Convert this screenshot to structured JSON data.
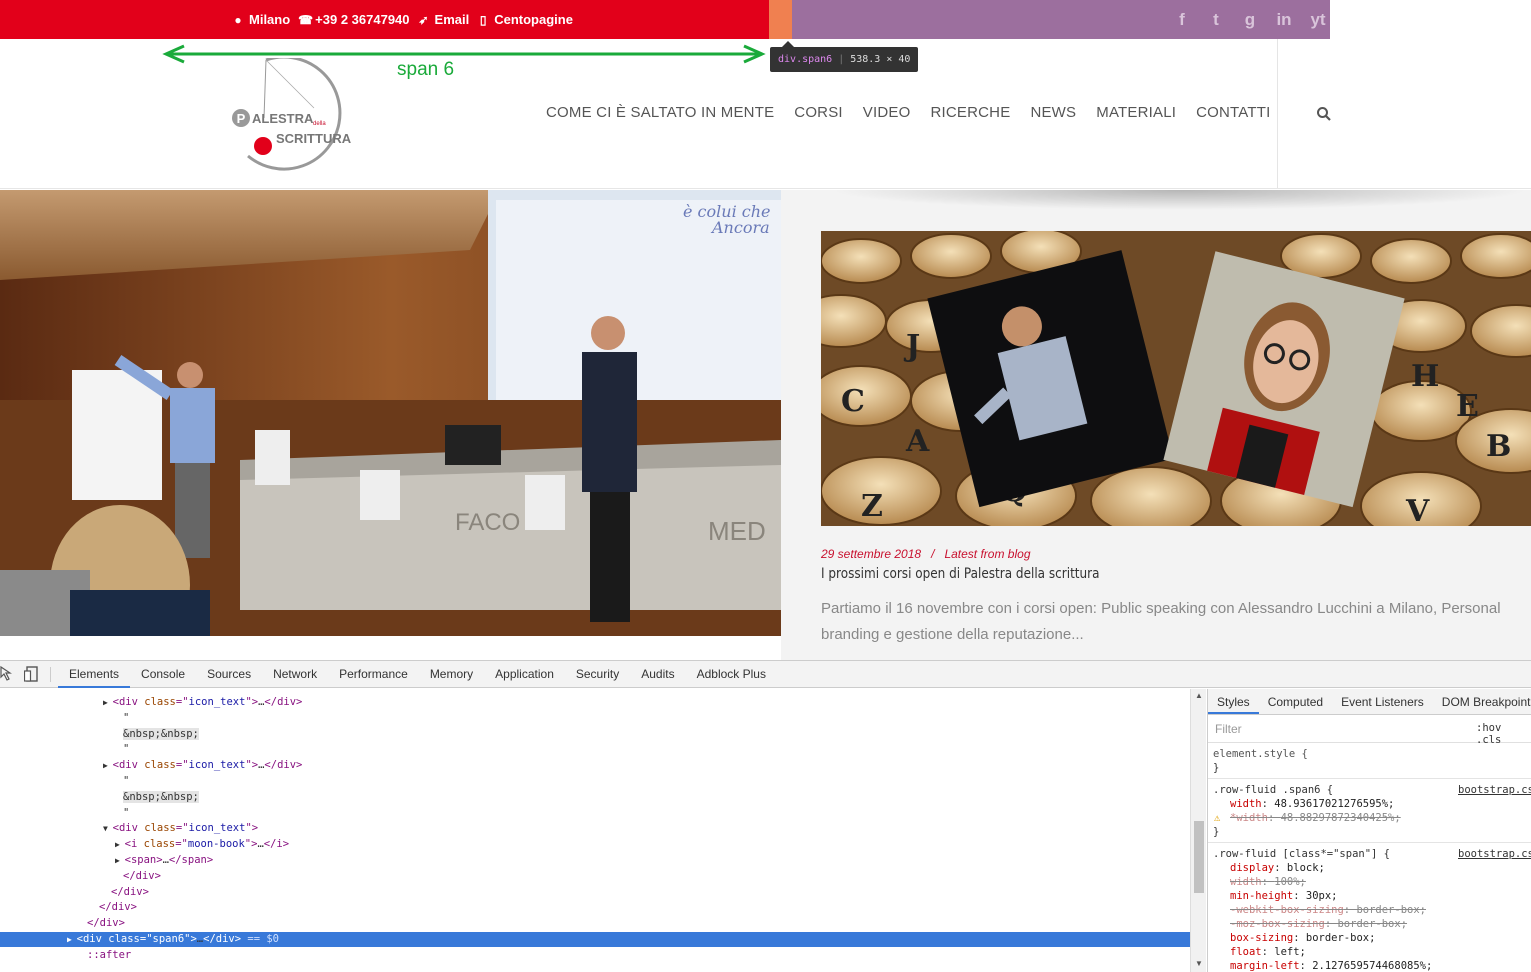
{
  "topbar": {
    "items": [
      {
        "icon": "map-marker-icon",
        "label": "Milano"
      },
      {
        "icon": "phone-icon",
        "label": "+39 2 36747940"
      },
      {
        "icon": "rocket-icon",
        "label": "Email"
      },
      {
        "icon": "book-icon",
        "label": "Centopagine"
      }
    ],
    "social": [
      "f",
      "t",
      "g",
      "in",
      "yt"
    ],
    "colors": {
      "red": "#e2001a",
      "purple": "#9c6f9e",
      "orange": "#f08050"
    }
  },
  "overlay": {
    "span_label": "span 6",
    "tooltip_tag": "div",
    "tooltip_class": ".span6",
    "tooltip_size": "538.3 × 40"
  },
  "logo": {
    "line1": "ALESTRA",
    "small": "della",
    "line2": "SCRITTURA",
    "initial": "P"
  },
  "nav": {
    "items": [
      "COME CI È SALTATO IN MENTE",
      "CORSI",
      "VIDEO",
      "RICERCHE",
      "NEWS",
      "MATERIALI",
      "CONTATTI"
    ]
  },
  "hero": {
    "slide_text_1": "è colui che",
    "slide_text_2": "Ancora",
    "desk_text": "FACO",
    "desk_text_2": "MED",
    "tiles": [
      "Q",
      "A",
      "B",
      "V",
      "H",
      "E",
      "Z",
      "C",
      "J"
    ]
  },
  "post": {
    "date": "29 settembre 2018",
    "separator": "/",
    "category": "Latest from blog",
    "title": "I prossimi corsi open di Palestra della scrittura",
    "excerpt": "Partiamo il 16 novembre con i corsi open: Public speaking con Alessandro Lucchini a Milano, Personal branding e gestione della reputazione..."
  },
  "devtools": {
    "tabs": [
      "Elements",
      "Console",
      "Sources",
      "Network",
      "Performance",
      "Memory",
      "Application",
      "Security",
      "Audits",
      "Adblock Plus"
    ],
    "active_tab": "Elements",
    "dom_lines": [
      {
        "indent": 113,
        "type": "collapsed",
        "tag": "div",
        "attr": "class",
        "value": "icon_text"
      },
      {
        "indent": 123,
        "type": "text",
        "text": "\""
      },
      {
        "indent": 123,
        "type": "entity",
        "text": "&nbsp;&nbsp;"
      },
      {
        "indent": 123,
        "type": "text",
        "text": "\""
      },
      {
        "indent": 113,
        "type": "collapsed",
        "tag": "div",
        "attr": "class",
        "value": "icon_text"
      },
      {
        "indent": 123,
        "type": "text",
        "text": "\""
      },
      {
        "indent": 123,
        "type": "entity",
        "text": "&nbsp;&nbsp;"
      },
      {
        "indent": 123,
        "type": "text",
        "text": "\""
      },
      {
        "indent": 113,
        "type": "open",
        "tag": "div",
        "attr": "class",
        "value": "icon_text"
      },
      {
        "indent": 125,
        "type": "collapsed",
        "tag": "i",
        "attr": "class",
        "value": "moon-book"
      },
      {
        "indent": 125,
        "type": "collapsed-noattr",
        "tag": "span"
      },
      {
        "indent": 123,
        "type": "close",
        "tag": "div"
      },
      {
        "indent": 111,
        "type": "close",
        "tag": "div"
      },
      {
        "indent": 99,
        "type": "close",
        "tag": "div"
      },
      {
        "indent": 87,
        "type": "close",
        "tag": "div"
      },
      {
        "indent": 77,
        "type": "selected",
        "tag": "div",
        "attr": "class",
        "value": "span6",
        "suffix": " == $0"
      },
      {
        "indent": 87,
        "type": "pseudo",
        "text": "::after"
      }
    ],
    "styles_tabs": [
      "Styles",
      "Computed",
      "Event Listeners",
      "DOM Breakpoints"
    ],
    "filter_placeholder": "Filter",
    "hov": ":hov  .cls",
    "element_style": "element.style {",
    "close_brace": "}",
    "rule1": {
      "selector": ".row-fluid .span6 {",
      "source": "bootstrap.css",
      "props": [
        {
          "name": "width",
          "value": "48.93617021276595%;",
          "struck": false
        },
        {
          "name": "*width",
          "value": "48.88297872340425%;",
          "struck": true,
          "warn": true
        }
      ]
    },
    "rule2": {
      "selector": ".row-fluid [class*=\"span\"] {",
      "source": "bootstrap.css",
      "props": [
        {
          "name": "display",
          "value": "block;",
          "struck": false
        },
        {
          "name": "width",
          "value": "100%;",
          "struck": true
        },
        {
          "name": "min-height",
          "value": "30px;",
          "struck": false
        },
        {
          "name": "-webkit-box-sizing",
          "value": "border-box;",
          "struck": true
        },
        {
          "name": "-moz-box-sizing",
          "value": "border-box;",
          "struck": true
        },
        {
          "name": "box-sizing",
          "value": "border-box;",
          "struck": false
        },
        {
          "name": "float",
          "value": "left;",
          "struck": false
        },
        {
          "name": "margin-left",
          "value": "2.127659574468085%;",
          "struck": false
        }
      ]
    }
  }
}
